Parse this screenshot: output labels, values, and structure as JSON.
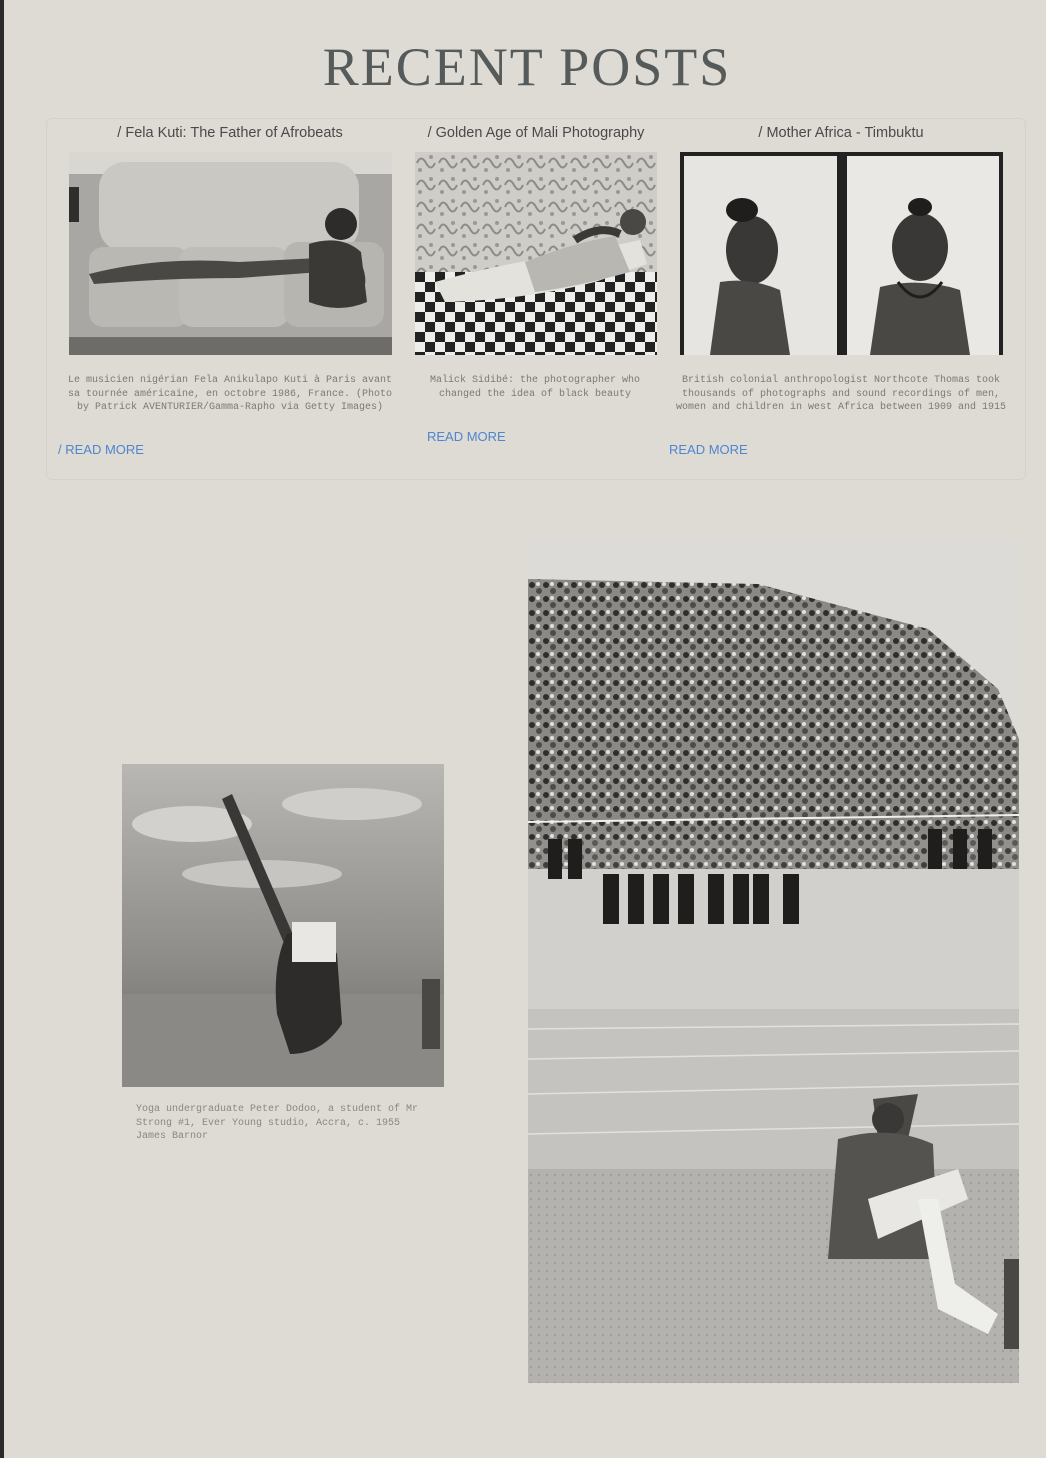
{
  "page": {
    "title": "RECENT POSTS"
  },
  "posts": [
    {
      "title": "/ Fela Kuti: The Father of Afrobeats",
      "caption": "Le musicien nigérian Fela Anikulapo Kuti à Paris avant sa tournée américaine, en octobre 1986, France. (Photo by Patrick AVENTURIER/Gamma-Rapho via Getty Images)",
      "read_more": "/ READ MORE"
    },
    {
      "title": "/ Golden Age of Mali Photography",
      "caption": "Malick Sidibé: the photographer who changed the idea of black beauty",
      "read_more": "READ MORE"
    },
    {
      "title": "/ Mother Africa - Timbuktu",
      "caption": "British colonial anthropologist Northcote Thomas took thousands of photographs and sound recordings of men, women and children in west Africa between 1909 and 1915",
      "read_more": "READ MORE"
    }
  ],
  "feature": {
    "caption_lines": [
      "Yoga undergraduate Peter Dodoo, a student of Mr",
      "Strong #1, Ever Young studio, Accra, c. 1955",
      "James Barnor"
    ]
  }
}
